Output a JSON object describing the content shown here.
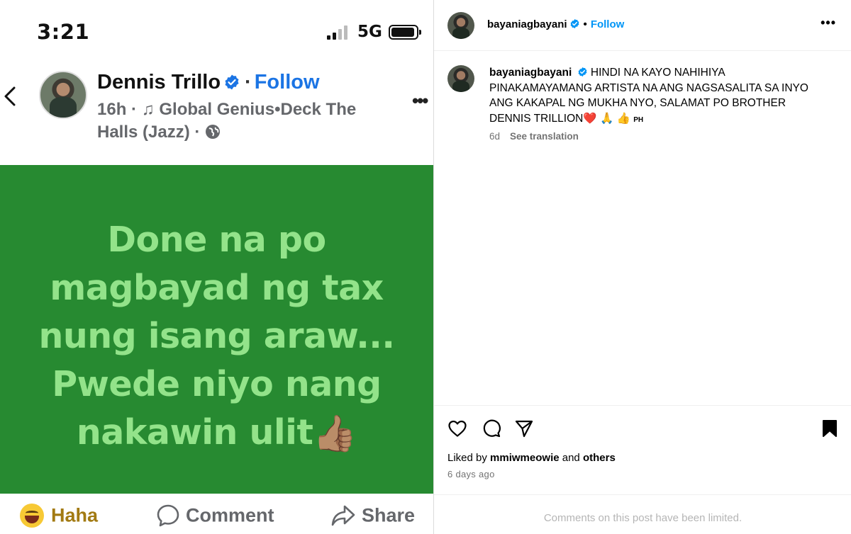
{
  "phone": {
    "status_bar": {
      "time": "3:21",
      "network": "5G",
      "icons": [
        "signal-icon",
        "battery-icon"
      ]
    },
    "post": {
      "author": "Dennis Trillo",
      "separator": "·",
      "follow": "Follow",
      "time": "16h",
      "meta_sep": "·",
      "music": "Global Genius",
      "song_sep": "•",
      "song": "Deck The Halls (Jazz)",
      "meta_sep2": "·",
      "card": {
        "lines": [
          "Done na po",
          "magbayad ng tax",
          "nung isang araw...",
          "Pwede niyo nang",
          "nakawin ulit"
        ],
        "emoji": "👍🏽",
        "background": "#278a31",
        "text_color": "#93e38a"
      }
    },
    "actions": {
      "haha": "Haha",
      "comment": "Comment",
      "share": "Share"
    }
  },
  "instagram": {
    "header": {
      "username": "bayaniagbayani",
      "dot": "•",
      "follow": "Follow"
    },
    "caption": {
      "username": "bayaniagbayani",
      "text": "HINDI NA KAYO NAHIHIYA PINAKAMAYAMANG ARTISTA NA ANG NAGSASALITA SA INYO ANG KAKAPAL NG MUKHA NYO, SALAMAT PO BROTHER DENNIS TRILLION",
      "heart": "❤️",
      "emojis": "🙏 👍",
      "flag": "PH",
      "age": "6d",
      "see_translation": "See translation"
    },
    "likes": {
      "prefix": "Liked by",
      "user": "mmiwmeowie",
      "mid": "and",
      "others": "others"
    },
    "posted": "6 days ago",
    "comments_note": "Comments on this post have been limited.",
    "accent": "#0095f6"
  }
}
